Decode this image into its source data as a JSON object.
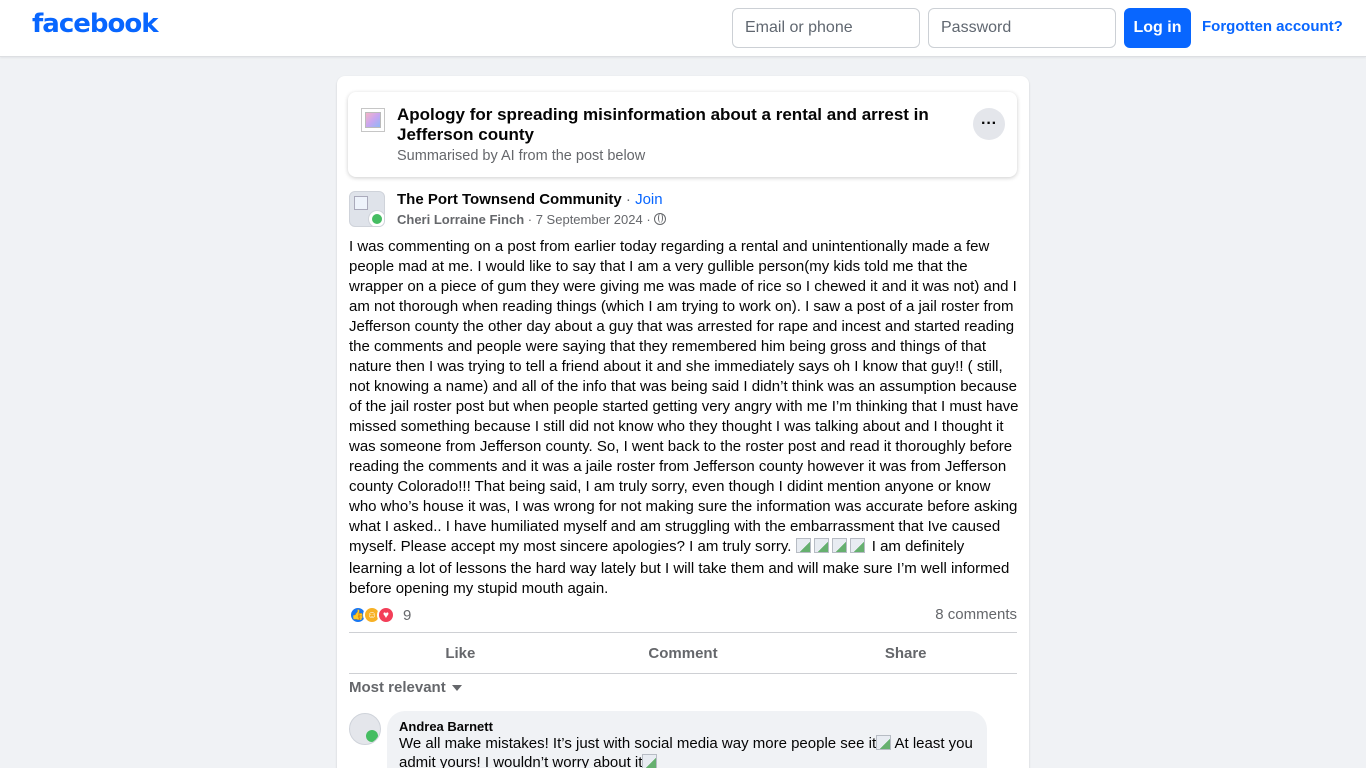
{
  "header": {
    "logo": "facebook",
    "email_placeholder": "Email or phone",
    "password_placeholder": "Password",
    "login_label": "Log in",
    "forgot_label": "Forgotten account?"
  },
  "ai_summary": {
    "title": "Apology for spreading misinformation about a rental and arrest in Jefferson county",
    "subtitle": "Summarised by AI from the post below",
    "more_label": "···"
  },
  "post": {
    "group_name": "The Port Townsend Community",
    "join_label": "Join",
    "author": "Cheri Lorraine Finch",
    "date": "7 September 2024",
    "body_main": "I was commenting on a post from earlier today regarding a rental and unintentionally made a few people mad at me. I would like to say that I am a very gullible person(my kids told me that the wrapper on  a piece of gum they were giving me was made of rice so I chewed it and it was not) and I am not thorough when reading things (which I am trying to work on). I saw a post of a jail roster from Jefferson county the other day about a guy that was arrested for rape and incest and started reading the comments  and people were saying that they remembered him being gross and  things of that nature then I was trying to tell a friend about it and she immediately says oh I know that guy!! ( still, not knowing a name)  and all of the info that was being said I didn’t think was an assumption because of the jail roster post but when people started getting very angry with me I’m thinking that I must have missed something because I still did not know who they thought I was talking about and I thought it was someone from Jefferson county.  So, I went back to the roster post and read it thoroughly before reading the comments and it was a jaile roster from Jefferson county however it was from Jefferson county Colorado!!!  That being said, I am truly sorry, even though I didint mention anyone or know who who’s house it was, I was wrong for not making sure the information was accurate before asking what I asked.. I have humiliated myself and am struggling with the embarrassment that Ive caused myself. Please accept my most sincere apologies? I am truly sorry.",
    "body_tail": "I am definitely learning a lot of lessons the hard way lately but I will take them and will make sure I’m well informed before opening my stupid mouth again.",
    "reaction_count": "9",
    "comments_count": "8 comments",
    "actions": {
      "like": "Like",
      "comment": "Comment",
      "share": "Share"
    },
    "sort_label": "Most relevant"
  },
  "comments": [
    {
      "author": "Andrea Barnett",
      "text_part1": "We all make mistakes! It’s just with social media way more people see it",
      "text_part2": " At least you admit yours! I wouldn’t worry about it"
    }
  ],
  "colors": {
    "brand": "#0866ff",
    "background": "#f0f2f5",
    "secondary_text": "#65676b"
  }
}
